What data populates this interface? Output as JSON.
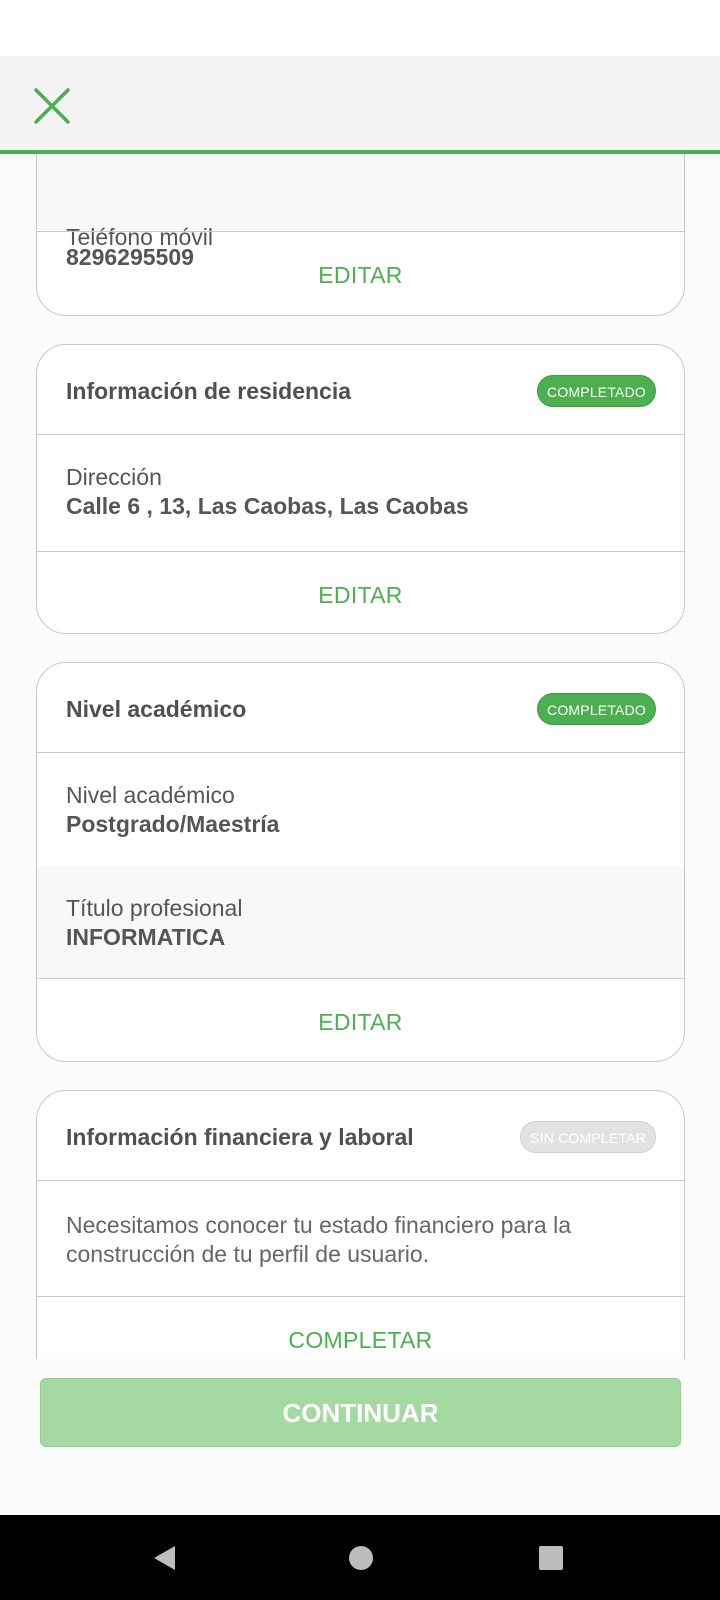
{
  "cards": {
    "contact": {
      "label": "Teléfono móvil",
      "value": "8296295509",
      "action": "EDITAR"
    },
    "residence": {
      "title": "Información de residencia",
      "badge": "COMPLETADO",
      "field_label": "Dirección",
      "field_value": "Calle 6 , 13, Las Caobas, Las Caobas",
      "action": "EDITAR"
    },
    "academic": {
      "title": "Nivel académico",
      "badge": "COMPLETADO",
      "fields": [
        {
          "label": "Nivel académico",
          "value": "Postgrado/Maestría"
        },
        {
          "label": "Título profesional",
          "value": "INFORMATICA"
        }
      ],
      "action": "EDITAR"
    },
    "financial": {
      "title": "Información financiera y laboral",
      "badge": "SIN COMPLETAR",
      "description": "Necesitamos conocer tu estado financiero para la construcción de tu perfil de usuario.",
      "action": "COMPLETAR"
    }
  },
  "continue_label": "CONTINUAR",
  "icons": {
    "close": "close-icon",
    "back": "back-triangle-icon",
    "home": "home-circle-icon",
    "recents": "recents-square-icon"
  },
  "colors": {
    "accent": "#4caf50",
    "continue_disabled": "#a5d9a2",
    "badge_pending": "#e2e2e2"
  }
}
